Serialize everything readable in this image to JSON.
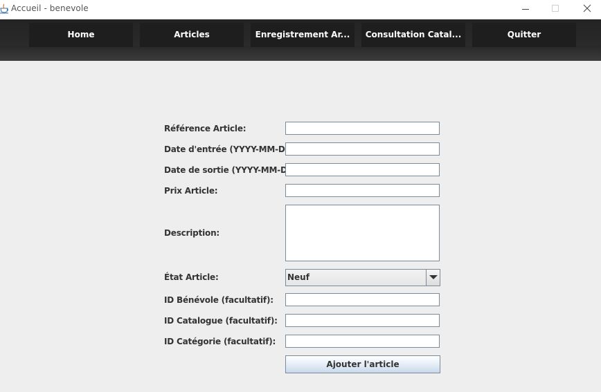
{
  "window": {
    "title": "Accueil - benevole"
  },
  "nav": {
    "items": [
      {
        "label": "Home"
      },
      {
        "label": "Articles"
      },
      {
        "label": "Enregistrement Ar..."
      },
      {
        "label": "Consultation Catal..."
      },
      {
        "label": "Quitter"
      }
    ]
  },
  "form": {
    "reference_label": "Référence Article:",
    "reference_value": "",
    "date_entree_label": "Date d'entrée (YYYY-MM-DD):",
    "date_entree_value": "",
    "date_sortie_label": "Date de sortie (YYYY-MM-DD):",
    "date_sortie_value": "",
    "prix_label": "Prix Article:",
    "prix_value": "",
    "description_label": "Description:",
    "description_value": "",
    "etat_label": "État Article:",
    "etat_value": "Neuf",
    "id_benevole_label": "ID Bénévole (facultatif):",
    "id_benevole_value": "",
    "id_catalogue_label": "ID Catalogue (facultatif):",
    "id_catalogue_value": "",
    "id_categorie_label": "ID Catégorie (facultatif):",
    "id_categorie_value": "",
    "submit_label": "Ajouter l'article"
  },
  "icons": {
    "app": "java-cup-icon",
    "minimize": "minimize-icon",
    "maximize": "maximize-icon",
    "close": "close-icon",
    "dropdown": "chevron-down-icon"
  },
  "colors": {
    "navbar": "#2a2a2a",
    "nav_button": "#1e1e1e",
    "nav_text": "#ffffff",
    "background": "#eeeeee",
    "field_border": "#7a8a99"
  }
}
